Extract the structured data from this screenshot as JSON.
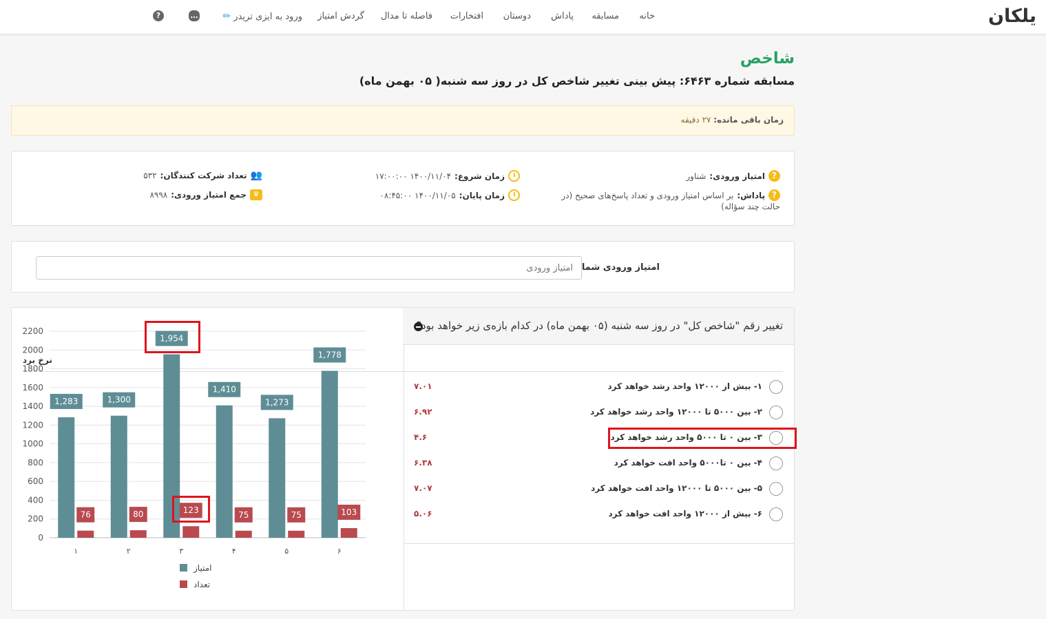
{
  "nav": {
    "logo": "یلکان",
    "items": [
      "خانه",
      "مسابقه",
      "پاداش",
      "دوستان",
      "افتخارات",
      "فاصله تا مدال",
      "گردش امتیاز",
      "ورود به ایزی تریدر"
    ],
    "icons": [
      "help-icon",
      "chat-icon",
      "pen-icon"
    ]
  },
  "page": {
    "title": "شاخص",
    "competition": "مسابقه شماره ۶۴۶۳: پیش بینی تغییر شاخص کل در روز سه شنبه( ۰۵ بهمن ماه)"
  },
  "alert": {
    "label": "زمان باقی مانده:",
    "value": "۲۷ دقیقه"
  },
  "info": {
    "entry_score_label": "امتیاز ورودی:",
    "entry_score_value": "شناور",
    "reward_label": "پاداش:",
    "reward_value": "بر اساس امتیاز ورودی و تعداد پاسخ‌های صحیح (در",
    "reward_value_2": "حالت چند سؤاله)",
    "start_label": "زمان شروع:",
    "start_value": "۱۴۰۰/۱۱/۰۴ ۱۷:۰۰:۰۰",
    "end_label": "زمان پایان:",
    "end_value": "۱۴۰۰/۱۱/۰۵ ۰۸:۴۵:۰۰",
    "participants_label": "تعداد شرکت کنندگان:",
    "participants_value": "۵۳۲",
    "total_label": "جمع امتیاز ورودی:",
    "total_value": "۸۹۹۸"
  },
  "entry_input": {
    "label": "امتیاز ورودی شما",
    "placeholder": "امتیاز ورودی"
  },
  "question": {
    "title": "تغییر رقم \"شاخص کل\" در روز سه شنبه (۰۵ بهمن ماه) در کدام بازه‌ی زیر خواهد بود؟",
    "rate_header": "نرخ برد",
    "options": [
      {
        "label": "۱- بیش از ۱۲۰۰۰ واحد رشد خواهد کرد",
        "rate": "۷.۰۱"
      },
      {
        "label": "۲- بین ۵۰۰۰ تا ۱۲۰۰۰ واحد رشد خواهد کرد",
        "rate": "۶.۹۲"
      },
      {
        "label": "۳- بین ۰ تا ۵۰۰۰ واحد رشد خواهد کرد",
        "rate": "۴.۶"
      },
      {
        "label": "۴- بین ۰ تا۵۰۰۰ واحد افت خواهد کرد",
        "rate": "۶.۳۸"
      },
      {
        "label": "۵- بین ۵۰۰۰ تا ۱۲۰۰۰ واحد افت خواهد کرد",
        "rate": "۷.۰۷"
      },
      {
        "label": "۶- بیش از ۱۲۰۰۰ واحد افت خواهد کرد",
        "rate": "۵.۰۶"
      }
    ]
  },
  "chart_data": {
    "type": "bar",
    "categories": [
      "۱",
      "۲",
      "۳",
      "۴",
      "۵",
      "۶"
    ],
    "series": [
      {
        "name": "امتیاز",
        "values": [
          1283,
          1300,
          1954,
          1410,
          1273,
          1778
        ],
        "labels": [
          "1,283",
          "1,300",
          "1,954",
          "1,410",
          "1,273",
          "1,778"
        ],
        "color": "#5f8d95"
      },
      {
        "name": "تعداد",
        "values": [
          76,
          80,
          123,
          75,
          75,
          103
        ],
        "labels": [
          "76",
          "80",
          "123",
          "75",
          "75",
          "103"
        ],
        "color": "#b94a4f"
      }
    ],
    "yticks": [
      "0",
      "200",
      "400",
      "600",
      "800",
      "1000",
      "1200",
      "1400",
      "1600",
      "1800",
      "2000",
      "2200"
    ],
    "ylim": [
      0,
      2200
    ],
    "grid": true,
    "legend": "bottom"
  },
  "colors": {
    "accent": "#27a263",
    "warning": "#f6bd19",
    "rate": "#b23a3a",
    "highlight": "#e0141c"
  }
}
